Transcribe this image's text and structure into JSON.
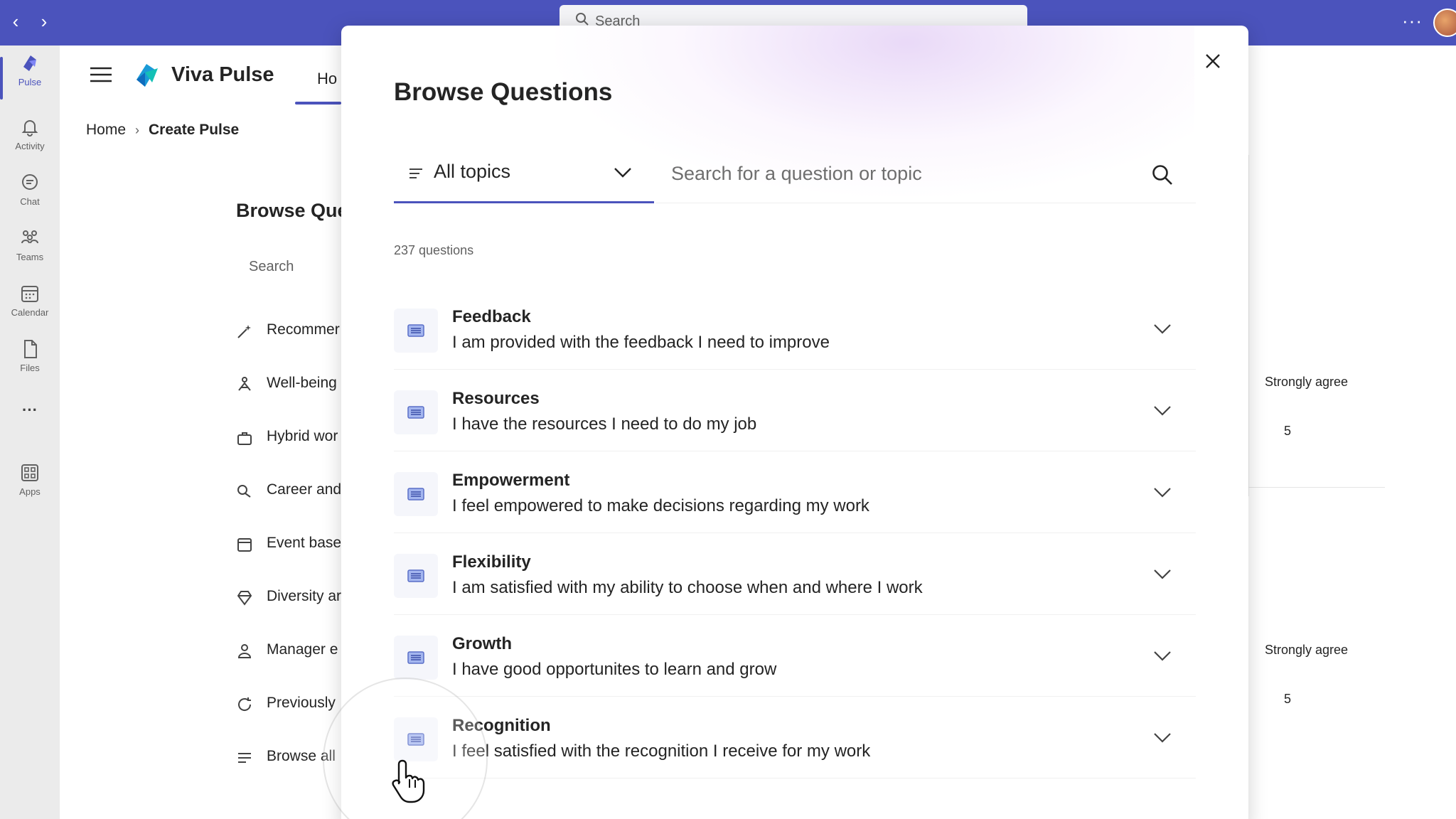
{
  "topbar": {
    "search_placeholder": "Search",
    "more": "···"
  },
  "rail": {
    "items": [
      {
        "label": "Pulse"
      },
      {
        "label": "Activity"
      },
      {
        "label": "Chat"
      },
      {
        "label": "Teams"
      },
      {
        "label": "Calendar"
      },
      {
        "label": "Files"
      },
      {
        "label": "···"
      },
      {
        "label": "Apps"
      }
    ]
  },
  "app": {
    "name": "Viva Pulse",
    "tab": "Ho",
    "breadcrumb": {
      "home": "Home",
      "separator": "›",
      "current": "Create Pulse"
    },
    "background": {
      "title": "Browse Que",
      "search": "Search",
      "list": [
        "Recommer",
        "Well-being",
        "Hybrid wor",
        "Career and",
        "Event base",
        "Diversity ar",
        "Manager e",
        "Previously",
        "Browse all"
      ],
      "right_labels": [
        "Strongly agree",
        "Strongly agree"
      ],
      "right_values": [
        "5",
        "5"
      ]
    }
  },
  "modal": {
    "title": "Browse Questions",
    "topic_filter": "All topics",
    "search_placeholder": "Search for a question or topic",
    "count": "237 questions",
    "questions": [
      {
        "topic": "Feedback",
        "text": "I am provided with the feedback I need to improve"
      },
      {
        "topic": "Resources",
        "text": "I have the resources I need to do my job"
      },
      {
        "topic": "Empowerment",
        "text": "I feel empowered to make decisions regarding my work"
      },
      {
        "topic": "Flexibility",
        "text": "I am satisfied with my ability to choose when and where I work"
      },
      {
        "topic": "Growth",
        "text": "I have good opportunites to learn and grow"
      },
      {
        "topic": "Recognition",
        "text": "I feel satisfied with the recognition I receive for my work"
      }
    ]
  },
  "colors": {
    "accent": "#4b53bc",
    "rail_bg": "#ebebeb"
  }
}
